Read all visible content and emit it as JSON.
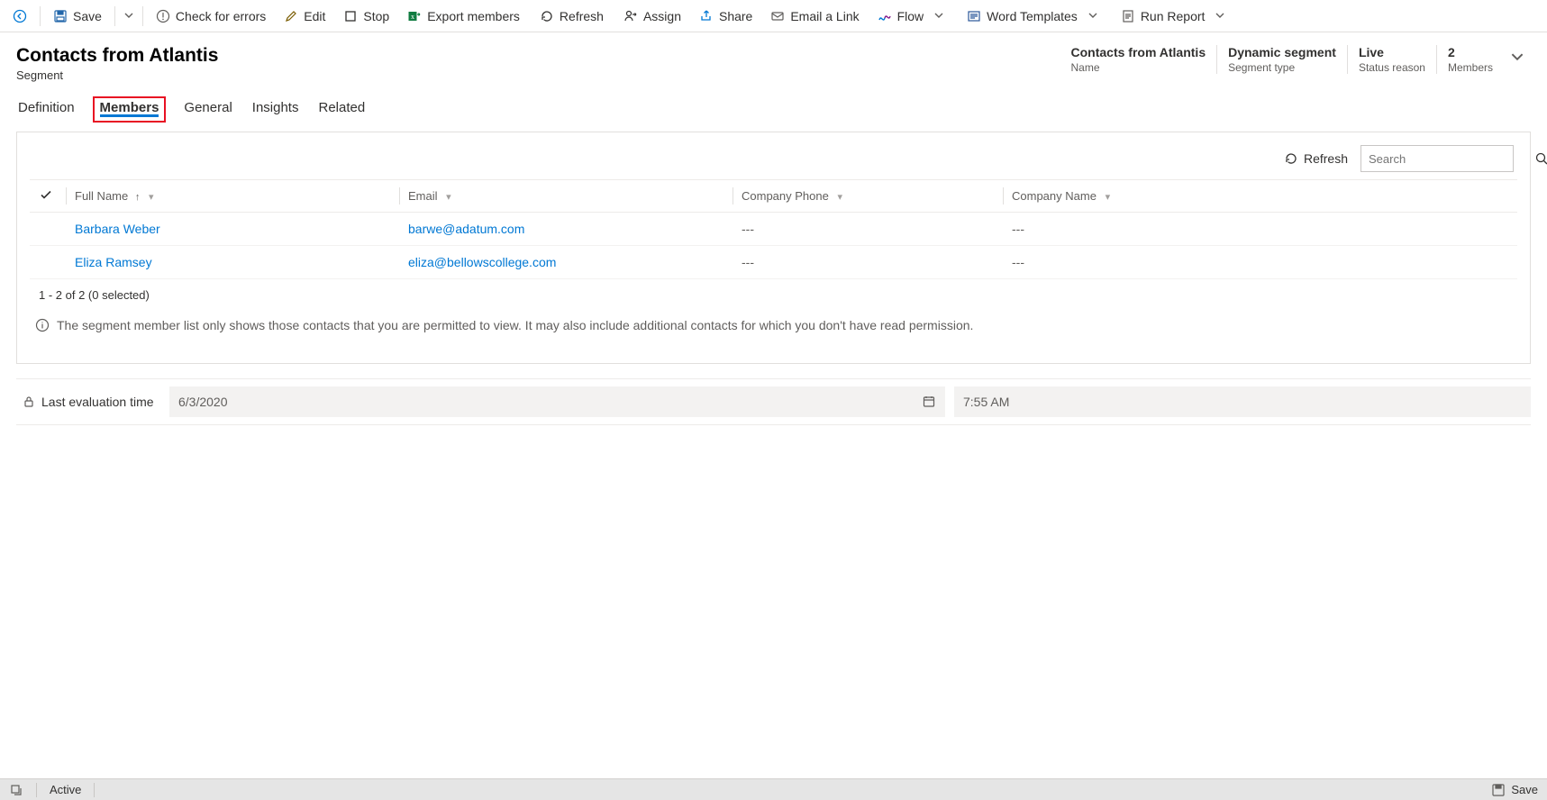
{
  "toolbar": {
    "save": "Save",
    "check_errors": "Check for errors",
    "edit": "Edit",
    "stop": "Stop",
    "export_members": "Export members",
    "refresh": "Refresh",
    "assign": "Assign",
    "share": "Share",
    "email_link": "Email a Link",
    "flow": "Flow",
    "word_templates": "Word Templates",
    "run_report": "Run Report"
  },
  "header": {
    "title": "Contacts from Atlantis",
    "subtitle": "Segment",
    "facts": [
      {
        "value": "Contacts from Atlantis",
        "label": "Name"
      },
      {
        "value": "Dynamic segment",
        "label": "Segment type"
      },
      {
        "value": "Live",
        "label": "Status reason"
      },
      {
        "value": "2",
        "label": "Members"
      }
    ]
  },
  "tabs": {
    "definition": "Definition",
    "members": "Members",
    "general": "General",
    "insights": "Insights",
    "related": "Related"
  },
  "grid": {
    "refresh_label": "Refresh",
    "search_placeholder": "Search",
    "columns": {
      "full_name": "Full Name",
      "email": "Email",
      "company_phone": "Company Phone",
      "company_name": "Company Name"
    },
    "rows": [
      {
        "full_name": "Barbara Weber",
        "email": "barwe@adatum.com",
        "company_phone": "---",
        "company_name": "---"
      },
      {
        "full_name": "Eliza Ramsey",
        "email": "eliza@bellowscollege.com",
        "company_phone": "---",
        "company_name": "---"
      }
    ],
    "paging": "1 - 2 of 2 (0 selected)",
    "info": "The segment member list only shows those contacts that you are permitted to view. It may also include additional contacts for which you don't have read permission."
  },
  "evaluation": {
    "label": "Last evaluation time",
    "date": "6/3/2020",
    "time": "7:55 AM"
  },
  "statusbar": {
    "status": "Active",
    "save": "Save"
  }
}
